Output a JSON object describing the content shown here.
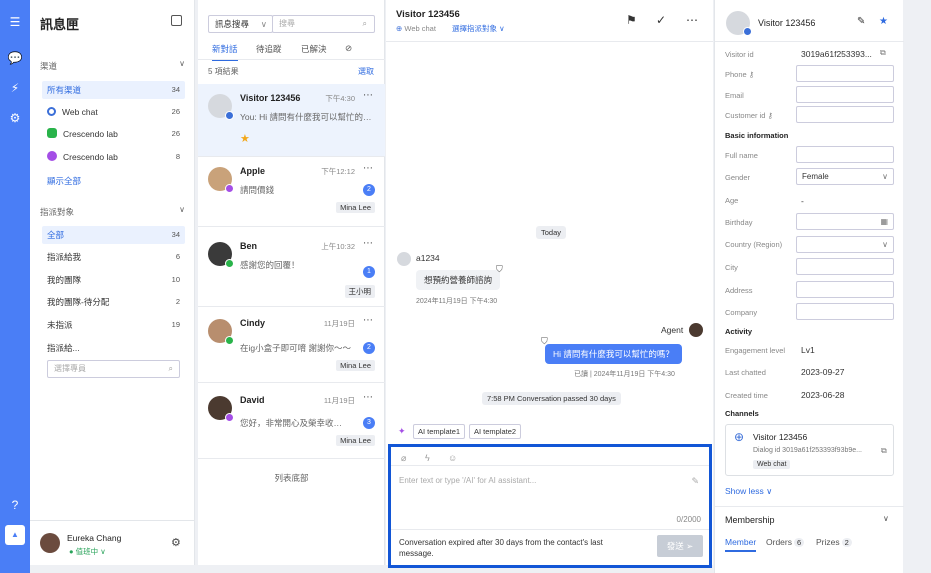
{
  "sidebar": {
    "title": "訊息匣",
    "channels_label": "渠道",
    "channels": [
      {
        "label": "所有渠道",
        "count": "34",
        "color": ""
      },
      {
        "label": "Web chat",
        "count": "26",
        "color": "#3b6fd8"
      },
      {
        "label": "Crescendo lab",
        "count": "26",
        "color": "#29b34a"
      },
      {
        "label": "Crescendo lab",
        "count": "8",
        "color": "#a44ee6"
      }
    ],
    "show_all": "顯示全部",
    "assign_label": "指派對象",
    "assign_items": [
      {
        "label": "全部",
        "count": "34"
      },
      {
        "label": "指派給我",
        "count": "6"
      },
      {
        "label": "我的團隊",
        "count": "10"
      },
      {
        "label": "我的團隊-待分配",
        "count": "2"
      },
      {
        "label": "未指派",
        "count": "19"
      },
      {
        "label": "指派給...",
        "count": ""
      }
    ],
    "member_search_placeholder": "選擇專員",
    "user_name": "Eureka Chang",
    "user_status": "● 值班中 ∨"
  },
  "list": {
    "filter": "訊息搜尋",
    "search_placeholder": "搜尋",
    "tabs": [
      "新對話",
      "待追蹤",
      "已解決"
    ],
    "count": "5 項結果",
    "pick": "選取",
    "conversations": [
      {
        "name": "Visitor 123456",
        "time": "下午4:30",
        "msg": "You: Hi 請問有什麼我可以幫忙的嗎？",
        "badge": "",
        "tag": "",
        "color": "#d6d9de"
      },
      {
        "name": "Apple",
        "time": "下午12:12",
        "msg": "請問價錢",
        "badge": "2",
        "tag": "Mina Lee",
        "color": "#c9a27a"
      },
      {
        "name": "Ben",
        "time": "上午10:32",
        "msg": "感謝您的回覆！",
        "badge": "1",
        "tag": "王小明",
        "color": "#3a3a3a"
      },
      {
        "name": "Cindy",
        "time": "11月19日",
        "msg": "在ig小盒子即可唷 謝謝你～～",
        "badge": "2",
        "tag": "Mina Lee",
        "color": "#b88e6e"
      },
      {
        "name": "David",
        "time": "11月19日",
        "msg": "您好，非常開心及榮幸收到您的訊息",
        "badge": "3",
        "tag": "Mina Lee",
        "color": "#4b3a30"
      }
    ],
    "end": "列表底部"
  },
  "chat": {
    "title": "Visitor 123456",
    "channel": "Web chat",
    "assign": "選擇指派對象 ∨",
    "date_pill": "Today",
    "in_sender": "a1234",
    "in_text": "想預約營養師諮詢",
    "in_time": "2024年11月19日 下午4:30",
    "out_sender": "Agent",
    "out_text": "Hi 請問有什麼我可以幫忙的嗎？",
    "out_meta": "已讀 | 2024年11月19日 下午4:30",
    "system_pill": "7:58 PM Conversation passed 30 days",
    "templates": [
      "AI template1",
      "AI template2"
    ],
    "placeholder": "Enter text or type '/AI' for AI assistant...",
    "char_count": "0/2000",
    "expired": "Conversation expired after 30 days from the contact's last message.",
    "send": "發送 ➢"
  },
  "profile": {
    "name": "Visitor 123456",
    "visitor_id_label": "Visitor id",
    "visitor_id": "3019a61f253393...",
    "phone": "Phone",
    "email": "Email",
    "customer_id": "Customer id",
    "basic_info": "Basic information",
    "full_name": "Full name",
    "gender_label": "Gender",
    "gender": "Female",
    "age_label": "Age",
    "age": "-",
    "birthday": "Birthday",
    "country": "Country (Region)",
    "city": "City",
    "address": "Address",
    "company": "Company",
    "activity": "Activity",
    "engagement_label": "Engagement level",
    "engagement": "Lv1",
    "last_chatted_label": "Last chatted",
    "last_chatted": "2023-09-27",
    "created_label": "Created time",
    "created": "2023-06-28",
    "channels": "Channels",
    "ch_name": "Visitor 123456",
    "ch_dialog": "Dialog id  3019a61f253393f93b9e...",
    "ch_tag": "Web chat",
    "show_less": "Show less ∨",
    "membership": "Membership",
    "tabs": [
      {
        "label": "Member",
        "count": ""
      },
      {
        "label": "Orders",
        "count": "6"
      },
      {
        "label": "Prizes",
        "count": "2"
      }
    ]
  }
}
